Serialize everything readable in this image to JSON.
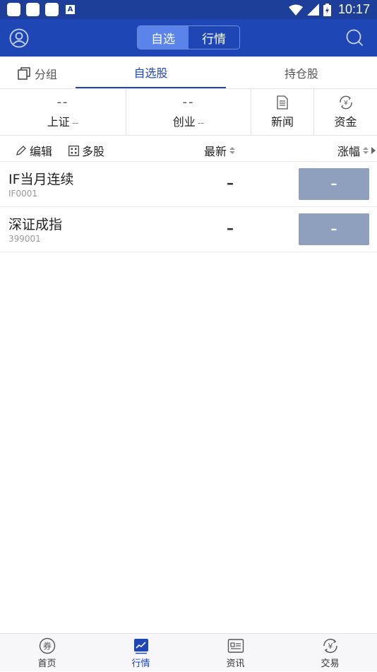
{
  "status_bar": {
    "time": "10:17",
    "notification_badge": "A"
  },
  "header": {
    "segments": [
      {
        "label": "自选",
        "active": true
      },
      {
        "label": "行情",
        "active": false
      }
    ]
  },
  "tabs": {
    "group_label": "分组",
    "items": [
      {
        "label": "自选股",
        "active": true
      },
      {
        "label": "持仓股",
        "active": false
      }
    ]
  },
  "index_bar": {
    "indices": [
      {
        "value": "--",
        "name": "上证",
        "change": "--"
      },
      {
        "value": "--",
        "name": "创业",
        "change": "--"
      }
    ],
    "quick_actions": [
      {
        "label": "新闻",
        "icon": "news-icon"
      },
      {
        "label": "资金",
        "icon": "fund-icon"
      }
    ]
  },
  "column_header": {
    "edit_label": "编辑",
    "multi_label": "多股",
    "latest_label": "最新",
    "change_label": "涨幅"
  },
  "watchlist": [
    {
      "name": "IF当月连续",
      "code": "IF0001",
      "last": "–",
      "change": "–"
    },
    {
      "name": "深证成指",
      "code": "399001",
      "last": "–",
      "change": "–"
    }
  ],
  "bottom_nav": [
    {
      "label": "首页",
      "icon": "coupon-icon",
      "active": false
    },
    {
      "label": "行情",
      "icon": "market-chart-icon",
      "active": true
    },
    {
      "label": "资讯",
      "icon": "news-card-icon",
      "active": false
    },
    {
      "label": "交易",
      "icon": "yuan-exchange-icon",
      "active": false
    }
  ],
  "colors": {
    "primary": "#1f46b5",
    "status_bar": "#1d3f9a",
    "segment_active": "#5b84ea",
    "change_box": "#8f9fbe"
  }
}
